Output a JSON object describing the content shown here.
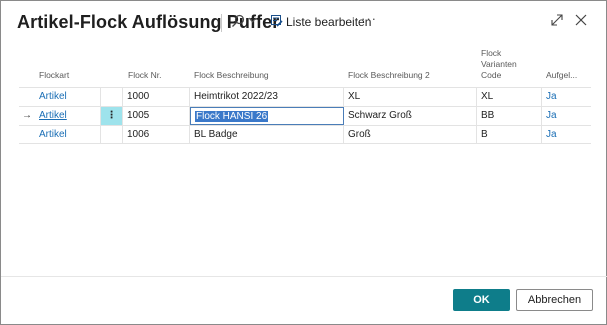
{
  "dialog": {
    "title": "Artikel-Flock Auflösung Puffer",
    "edit_list_label": "Liste bearbeiten",
    "more_label": "···"
  },
  "columns": [
    {
      "key": "flockart",
      "label": "Flockart"
    },
    {
      "key": "flock_nr",
      "label": "Flock Nr."
    },
    {
      "key": "beschreibung",
      "label": "Flock Beschreibung"
    },
    {
      "key": "beschreibung2",
      "label": "Flock Beschreibung 2"
    },
    {
      "key": "varianten_code",
      "label": "Flock\nVarianten\nCode"
    },
    {
      "key": "aufgeloest",
      "label": "Aufgel..."
    }
  ],
  "rows": [
    {
      "arrow": "",
      "flockart": "Artikel",
      "dots": "",
      "flock_nr": "1000",
      "beschreibung": "Heimtrikot 2022/23",
      "beschreibung2": "XL",
      "varianten_code": "XL",
      "aufgeloest": "Ja"
    },
    {
      "arrow": "→",
      "flockart": "Artikel",
      "dots": "⋮",
      "flock_nr": "1005",
      "beschreibung": "Flock HANSI 26",
      "beschreibung2": "Schwarz Groß",
      "varianten_code": "BB",
      "aufgeloest": "Ja"
    },
    {
      "arrow": "",
      "flockart": "Artikel",
      "dots": "",
      "flock_nr": "1006",
      "beschreibung": "BL Badge",
      "beschreibung2": "Groß",
      "varianten_code": "B",
      "aufgeloest": "Ja"
    }
  ],
  "footer": {
    "ok_label": "OK",
    "cancel_label": "Abbrechen"
  },
  "colors": {
    "accent": "#0e7d8a",
    "link": "#1a6eb5",
    "active_cell": "#9ee3ec",
    "selection": "#3a78c9"
  }
}
